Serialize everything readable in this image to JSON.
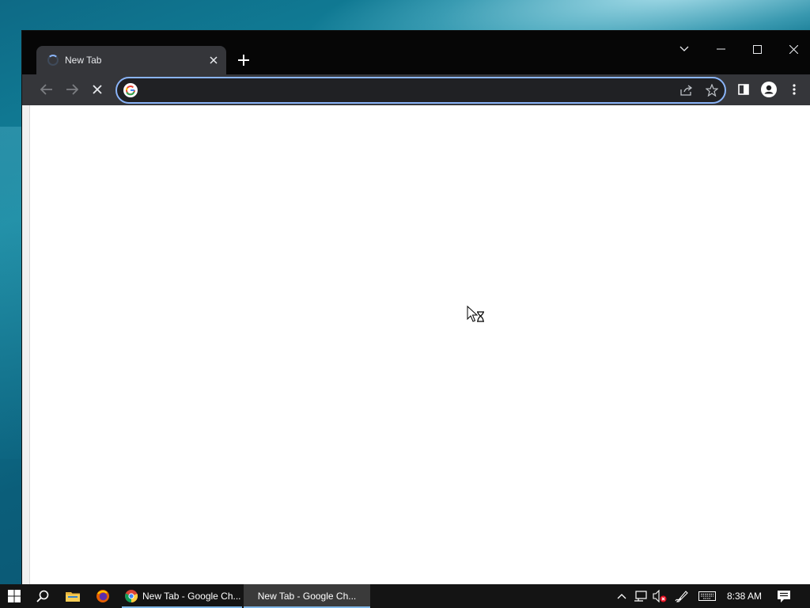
{
  "browser": {
    "tab": {
      "title": "New Tab"
    },
    "omnibox": {
      "value": "",
      "placeholder": ""
    }
  },
  "taskbar": {
    "apps": [
      {
        "label": "New Tab - Google Ch..."
      },
      {
        "label": "New Tab - Google Ch..."
      }
    ],
    "clock": "8:38 AM"
  },
  "colors": {
    "accent": "#8ab4f8",
    "titlebar": "#060606",
    "toolbar": "#35363a",
    "taskbar": "#141414"
  },
  "icons": [
    "loading-spinner-icon",
    "close-icon",
    "plus-icon",
    "chevron-down-icon",
    "minimize-icon",
    "maximize-icon",
    "close-window-icon",
    "back-arrow-icon",
    "forward-arrow-icon",
    "stop-loading-icon",
    "google-icon",
    "share-icon",
    "star-icon",
    "side-panel-icon",
    "profile-icon",
    "more-vert-icon",
    "windows-start-icon",
    "search-icon",
    "file-explorer-icon",
    "firefox-icon",
    "chrome-icon",
    "chevron-up-icon",
    "network-icon",
    "volume-muted-icon",
    "pen-icon",
    "keyboard-icon",
    "notifications-icon",
    "busy-cursor-icon"
  ]
}
